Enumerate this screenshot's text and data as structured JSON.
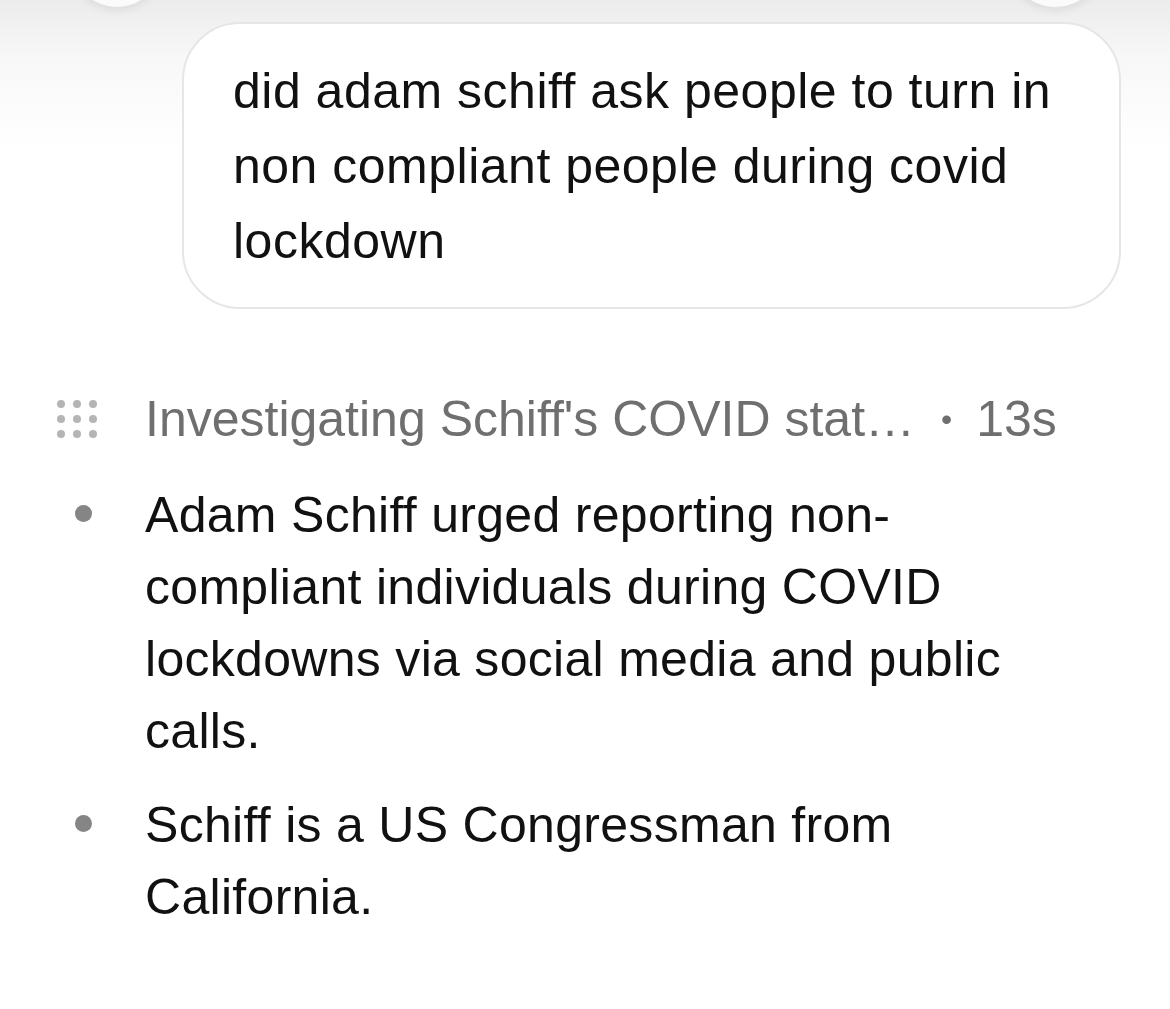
{
  "message": {
    "text": "did adam schiff ask people to turn in non compliant people during covid lockdown"
  },
  "status": {
    "label": "Investigating Schiff's COVID stat…",
    "separator": "•",
    "elapsed": "13s"
  },
  "bullets": [
    {
      "text": "Adam Schiff urged reporting non-compliant individuals during COVID lockdowns via social media and public calls."
    },
    {
      "text": "Schiff is a US Congressman from California."
    }
  ]
}
